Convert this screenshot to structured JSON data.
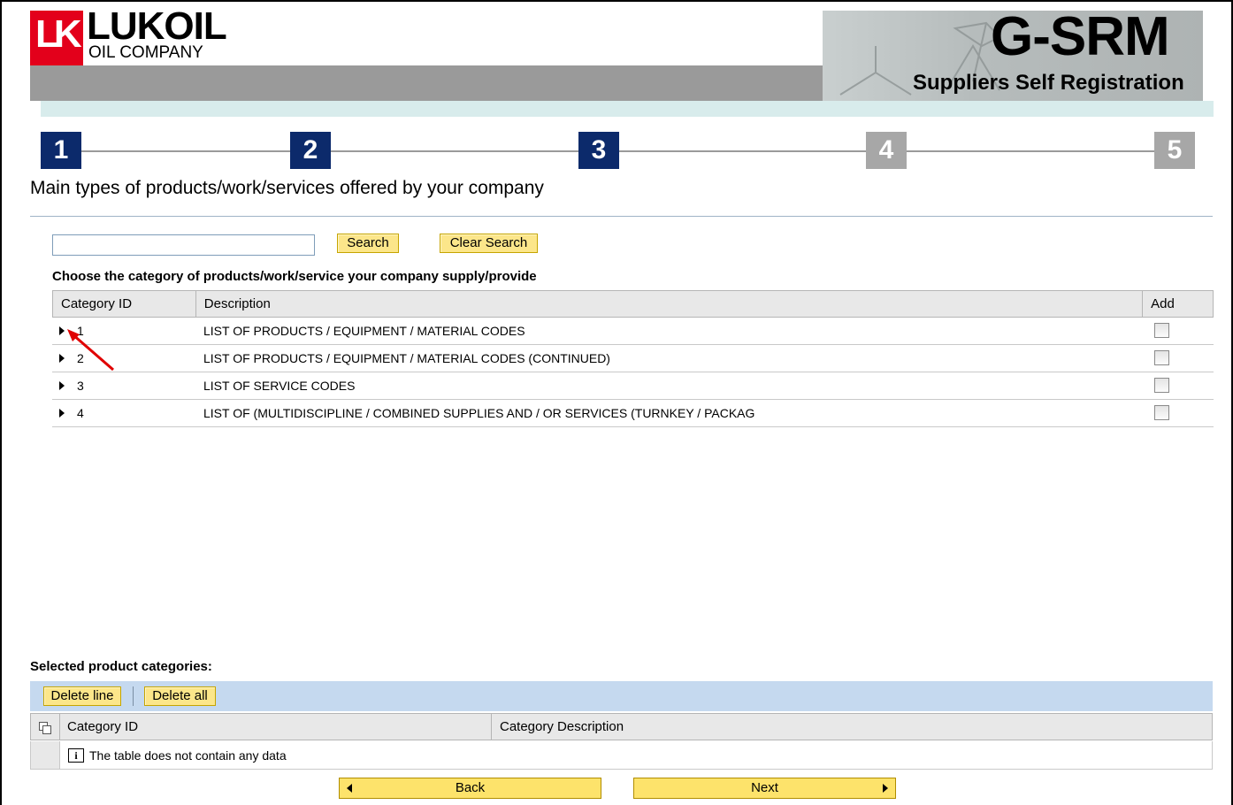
{
  "header": {
    "logo_mark": "LK",
    "brand": "LUKOIL",
    "brand_sub": "OIL COMPANY",
    "app_name": "G-SRM",
    "app_subtitle": "Suppliers Self Registration",
    "brand_color": "#e3001b"
  },
  "steps": [
    {
      "label": "1",
      "state": "active"
    },
    {
      "label": "2",
      "state": "active"
    },
    {
      "label": "3",
      "state": "active"
    },
    {
      "label": "4",
      "state": "inactive"
    },
    {
      "label": "5",
      "state": "inactive"
    }
  ],
  "page_title": "Main types of products/work/services offered by your company",
  "search": {
    "value": "",
    "search_button": "Search",
    "clear_button": "Clear Search"
  },
  "categories": {
    "instruction": "Choose the category of products/work/service your company supply/provide",
    "columns": {
      "id": "Category ID",
      "description": "Description",
      "add": "Add"
    },
    "rows": [
      {
        "id": "1",
        "description": "LIST OF PRODUCTS / EQUIPMENT / MATERIAL CODES",
        "checked": false
      },
      {
        "id": "2",
        "description": "LIST OF PRODUCTS / EQUIPMENT / MATERIAL CODES (CONTINUED)",
        "checked": false
      },
      {
        "id": "3",
        "description": "LIST OF SERVICE CODES",
        "checked": false
      },
      {
        "id": "4",
        "description": "LIST OF (MULTIDISCIPLINE / COMBINED SUPPLIES AND / OR SERVICES (TURNKEY / PACKAG",
        "checked": false
      }
    ]
  },
  "selected": {
    "label": "Selected product categories:",
    "delete_line": "Delete line",
    "delete_all": "Delete all",
    "columns": {
      "id": "Category ID",
      "description": "Category Description"
    },
    "empty_message": "The table does not contain any data"
  },
  "nav": {
    "back": "Back",
    "next": "Next"
  }
}
